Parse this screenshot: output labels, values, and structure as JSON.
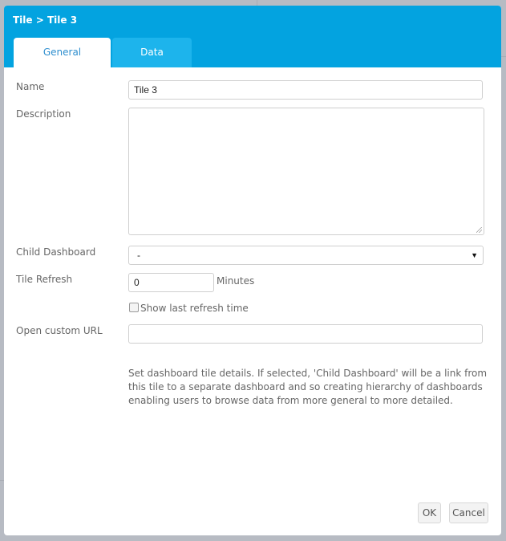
{
  "dialog": {
    "title": "Tile > Tile 3",
    "tabs": [
      {
        "label": "General",
        "active": true
      },
      {
        "label": "Data",
        "active": false
      }
    ]
  },
  "form": {
    "name": {
      "label": "Name",
      "value": "Tile 3"
    },
    "description": {
      "label": "Description",
      "value": ""
    },
    "child_dashboard": {
      "label": "Child Dashboard",
      "selected": "-",
      "arrow_icon": "▼"
    },
    "tile_refresh": {
      "label": "Tile Refresh",
      "value": "0",
      "unit": "Minutes"
    },
    "show_last_refresh": {
      "label": "Show last refresh time",
      "checked": false
    },
    "custom_url": {
      "label": "Open custom URL",
      "value": ""
    }
  },
  "help_text": "Set dashboard tile details. If selected, 'Child Dashboard' will be a link from this tile to a separate dashboard and so creating hierarchy of dashboards enabling users to browse data from more general to more detailed.",
  "buttons": {
    "ok": "OK",
    "cancel": "Cancel"
  },
  "colors": {
    "header": "#03a3e0",
    "inactive_tab": "#1db4ec",
    "active_tab_text": "#2f8fcf"
  }
}
